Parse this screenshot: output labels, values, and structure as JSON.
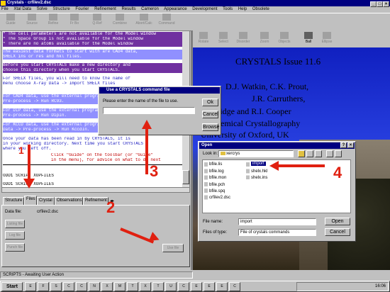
{
  "window": {
    "title": "Crystals   ·   crfilev2.dsc"
  },
  "menu": [
    "File",
    "Xtal Data",
    "Solve",
    "Structure",
    "Fourier",
    "Refinement",
    "Results",
    "Cameron",
    "Appearance",
    "Development",
    "Tools",
    "Help",
    "Obsolete"
  ],
  "toolbar": [
    "Guide",
    "Source",
    "Refine",
    "Fr Bo",
    "Q-Ref",
    "Combine",
    "Abort/Calc",
    "Command"
  ],
  "messages": [
    {
      "cls": "purple",
      "text": "* The cell parameters are not available for the Model window"
    },
    {
      "cls": "purple",
      "text": "* The Space Group is not available for the Model window"
    },
    {
      "cls": "purple",
      "text": "* There are no atoms available for the Model window"
    },
    {
      "cls": "blue",
      "text": "The easiest data formats to start with are CAD4 data,"
    },
    {
      "cls": "blue",
      "text": "SHELX ins or res and hkl files."
    },
    {
      "cls": "red",
      "text": "Before you start CRYSTALS make a new directory and"
    },
    {
      "cls": "red",
      "text": "choose this directory when you start CRYSTALS."
    },
    {
      "cls": "blue",
      "text": "For SHELX files, you will need to know the name of"
    },
    {
      "cls": "blue",
      "text": "menu choose X-ray Data -> Import SHELX files"
    },
    {
      "cls": "blue",
      "text": "For CAD4 data, use the external program"
    },
    {
      "cls": "blue",
      "text": "Pre-process -> Run RC93."
    },
    {
      "cls": "blue",
      "text": "For DIP data, use the external program"
    },
    {
      "cls": "blue",
      "text": "Pre-process -> Run DipIn."
    },
    {
      "cls": "blue",
      "text": "For KCCD data, use the external program"
    },
    {
      "cls": "blue",
      "text": "Data -> Pre-process -> Run KccdIn."
    },
    {
      "cls": "blue",
      "text": "Once your data has been read in by CRYSTALS, it is"
    },
    {
      "cls": "blue",
      "text": "in your working directory. Next time you start CRYSTALS"
    },
    {
      "cls": "blue",
      "text": "where you left off."
    },
    {
      "cls": "purple",
      "text": "Click \"Guide\" on the toolbar (or \"Guide\""
    },
    {
      "cls": "purple",
      "text": "in the menu), for advice on what to do next"
    }
  ],
  "script_lines": [
    "ODD1    SCRIPT  XOPFILES",
    "ODD1    SCRIPT  XOPFILES"
  ],
  "tabs": [
    "Structure",
    "Files",
    "Crystal",
    "Observations",
    "Refinement"
  ],
  "files_panel": {
    "data_file_label": "Data file:",
    "data_file_value": "crfilev2.dsc",
    "buttons": [
      "Listing file",
      "Log file",
      "Punch file",
      "Use file"
    ]
  },
  "status_bar": "SCRIPTS - Awaiting User Action",
  "model_toolbar": [
    "Rotate",
    "Select",
    "Disorder",
    "Zoom",
    "Objects",
    "Ball",
    "Ellipse"
  ],
  "splash": {
    "title": "CRYSTALS Issue 11.6",
    "lines": [
      "D.J. Watkin, C.K. Prout,",
      "J.R. Carruthers,",
      ", Betteridge and R.I. Cooper",
      "001 Chemical Crystallography",
      "University of Oxford, UK"
    ]
  },
  "command_dialog": {
    "title": "Use a CRYSTALS command file",
    "prompt": "Please enter the name of the file to use.",
    "input_value": "",
    "buttons": [
      "Ok",
      "Cancel",
      "Browse"
    ]
  },
  "open_dialog": {
    "title": "Open",
    "look_in_label": "Look in:",
    "look_in_value": "xercrys",
    "files": [
      "bfile.lis",
      "bfile.log",
      "bfile.mon",
      "bfile.pch",
      "bfile.spq",
      "crfilev2.dsc"
    ],
    "files_col2": [
      "import",
      "shelx.hkl",
      "shelx.ins"
    ],
    "filename_label": "File name:",
    "filename_value": "import",
    "filetype_label": "Files of type:",
    "filetype_value": "File of crystals commands",
    "open_button": "Open",
    "cancel_button": "Cancel"
  },
  "annotations": [
    "1",
    "2",
    "3",
    "4"
  ],
  "taskbar": {
    "start": "Start",
    "items": [
      "E",
      "F",
      "S",
      "C",
      "C",
      "N",
      "X",
      "M",
      "T",
      "X",
      "T",
      "U",
      "C",
      "E",
      "E",
      "E",
      "C"
    ],
    "clock": "16:06"
  }
}
